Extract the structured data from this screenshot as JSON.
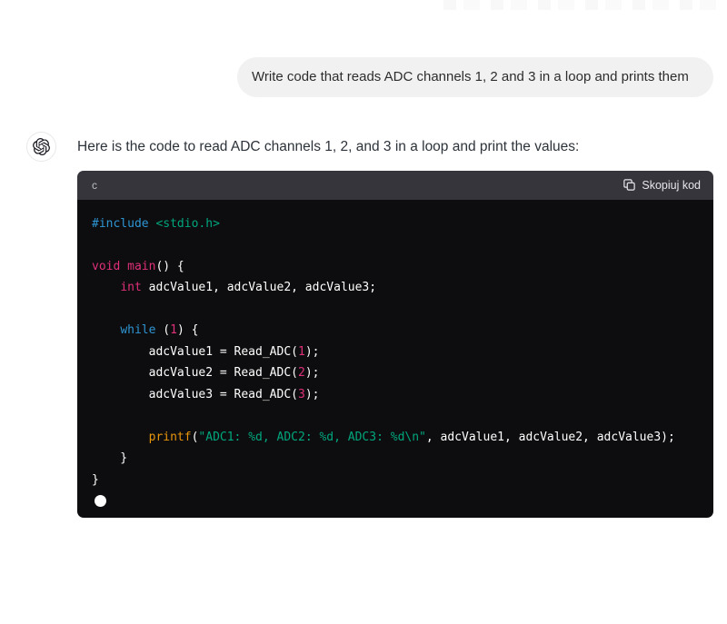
{
  "user_message": {
    "text": "Write code that reads ADC channels 1, 2 and 3 in a loop and prints them",
    "bubble_color": "#f1f1f1"
  },
  "assistant_message": {
    "intro": "Here is the code to read ADC channels 1, 2, and 3 in a loop and print the values:",
    "avatar_icon": "openai-logo-icon"
  },
  "code_block": {
    "language_label": "c",
    "copy_button": {
      "icon": "copy-icon",
      "label": "Skopiuj kod"
    },
    "header_bg": "#35353b",
    "body_bg": "#0d0d0f",
    "syntax_colors": {
      "keyword": "#2e95d3",
      "string": "#00a67d",
      "decl": "#df3079",
      "func": "#e9950c",
      "plain": "#ffffff"
    },
    "lines": [
      [
        {
          "t": "#include",
          "c": "keyword"
        },
        {
          "t": " ",
          "c": "plain"
        },
        {
          "t": "<stdio.h>",
          "c": "string"
        }
      ],
      [],
      [
        {
          "t": "void",
          "c": "decl"
        },
        {
          "t": " ",
          "c": "plain"
        },
        {
          "t": "main",
          "c": "decl"
        },
        {
          "t": "() {",
          "c": "plain"
        }
      ],
      [
        {
          "t": "    ",
          "c": "plain"
        },
        {
          "t": "int",
          "c": "decl"
        },
        {
          "t": " adcValue1, adcValue2, adcValue3;",
          "c": "plain"
        }
      ],
      [],
      [
        {
          "t": "    ",
          "c": "plain"
        },
        {
          "t": "while",
          "c": "keyword"
        },
        {
          "t": " (",
          "c": "plain"
        },
        {
          "t": "1",
          "c": "decl"
        },
        {
          "t": ") {",
          "c": "plain"
        }
      ],
      [
        {
          "t": "        adcValue1 = Read_ADC(",
          "c": "plain"
        },
        {
          "t": "1",
          "c": "decl"
        },
        {
          "t": ");",
          "c": "plain"
        }
      ],
      [
        {
          "t": "        adcValue2 = Read_ADC(",
          "c": "plain"
        },
        {
          "t": "2",
          "c": "decl"
        },
        {
          "t": ");",
          "c": "plain"
        }
      ],
      [
        {
          "t": "        adcValue3 = Read_ADC(",
          "c": "plain"
        },
        {
          "t": "3",
          "c": "decl"
        },
        {
          "t": ");",
          "c": "plain"
        }
      ],
      [],
      [
        {
          "t": "        ",
          "c": "plain"
        },
        {
          "t": "printf",
          "c": "func"
        },
        {
          "t": "(",
          "c": "plain"
        },
        {
          "t": "\"ADC1: %d, ADC2: %d, ADC3: %d\\n\"",
          "c": "string"
        },
        {
          "t": ", adcValue1, adcValue2, adcValue3);",
          "c": "plain"
        }
      ],
      [
        {
          "t": "    }",
          "c": "plain"
        }
      ],
      [
        {
          "t": "}",
          "c": "plain"
        }
      ]
    ],
    "streaming_cursor": true
  }
}
